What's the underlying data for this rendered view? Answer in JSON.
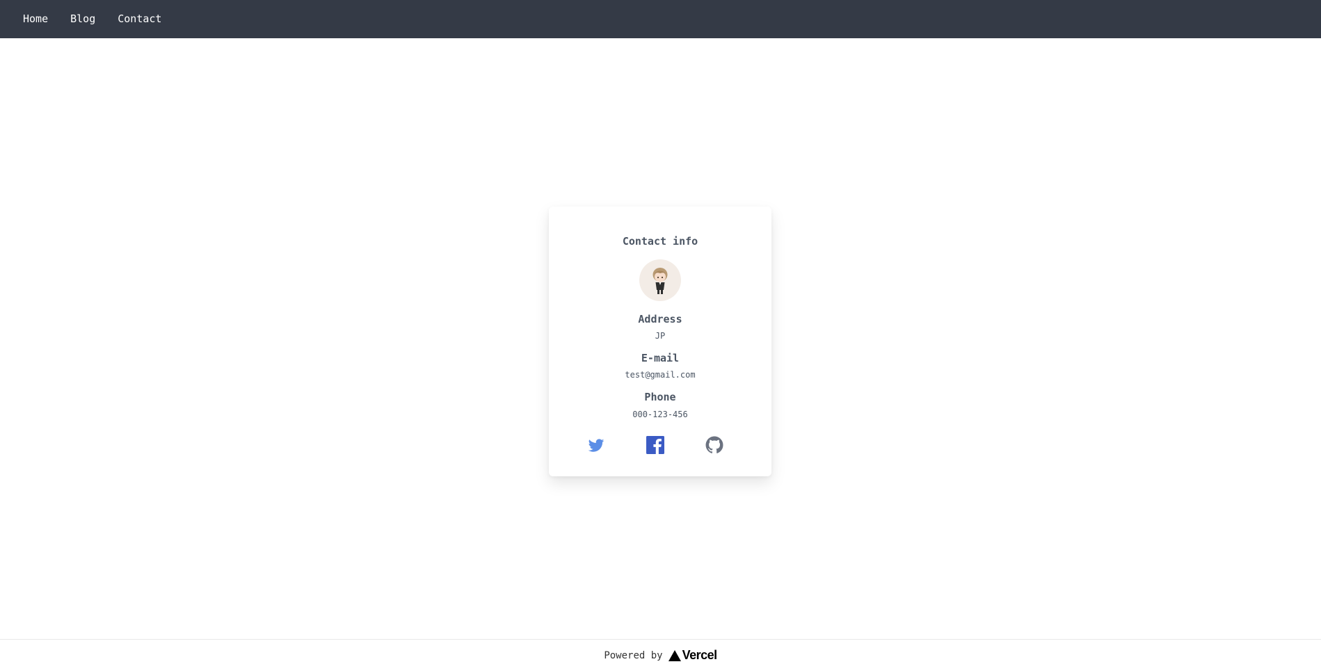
{
  "nav": {
    "items": [
      {
        "label": "Home"
      },
      {
        "label": "Blog"
      },
      {
        "label": "Contact"
      }
    ]
  },
  "contact": {
    "title": "Contact info",
    "avatar_icon": "chibi-character-avatar",
    "address_label": "Address",
    "address_value": "JP",
    "email_label": "E-mail",
    "email_value": "test@gmail.com",
    "phone_label": "Phone",
    "phone_value": "000-123-456",
    "socials": [
      {
        "icon": "twitter-icon",
        "color": "#5c8ee6"
      },
      {
        "icon": "facebook-icon",
        "color": "#3b5bc4"
      },
      {
        "icon": "github-icon",
        "color": "#6b7280"
      }
    ]
  },
  "footer": {
    "powered_label": "Powered by",
    "brand": "Vercel"
  }
}
